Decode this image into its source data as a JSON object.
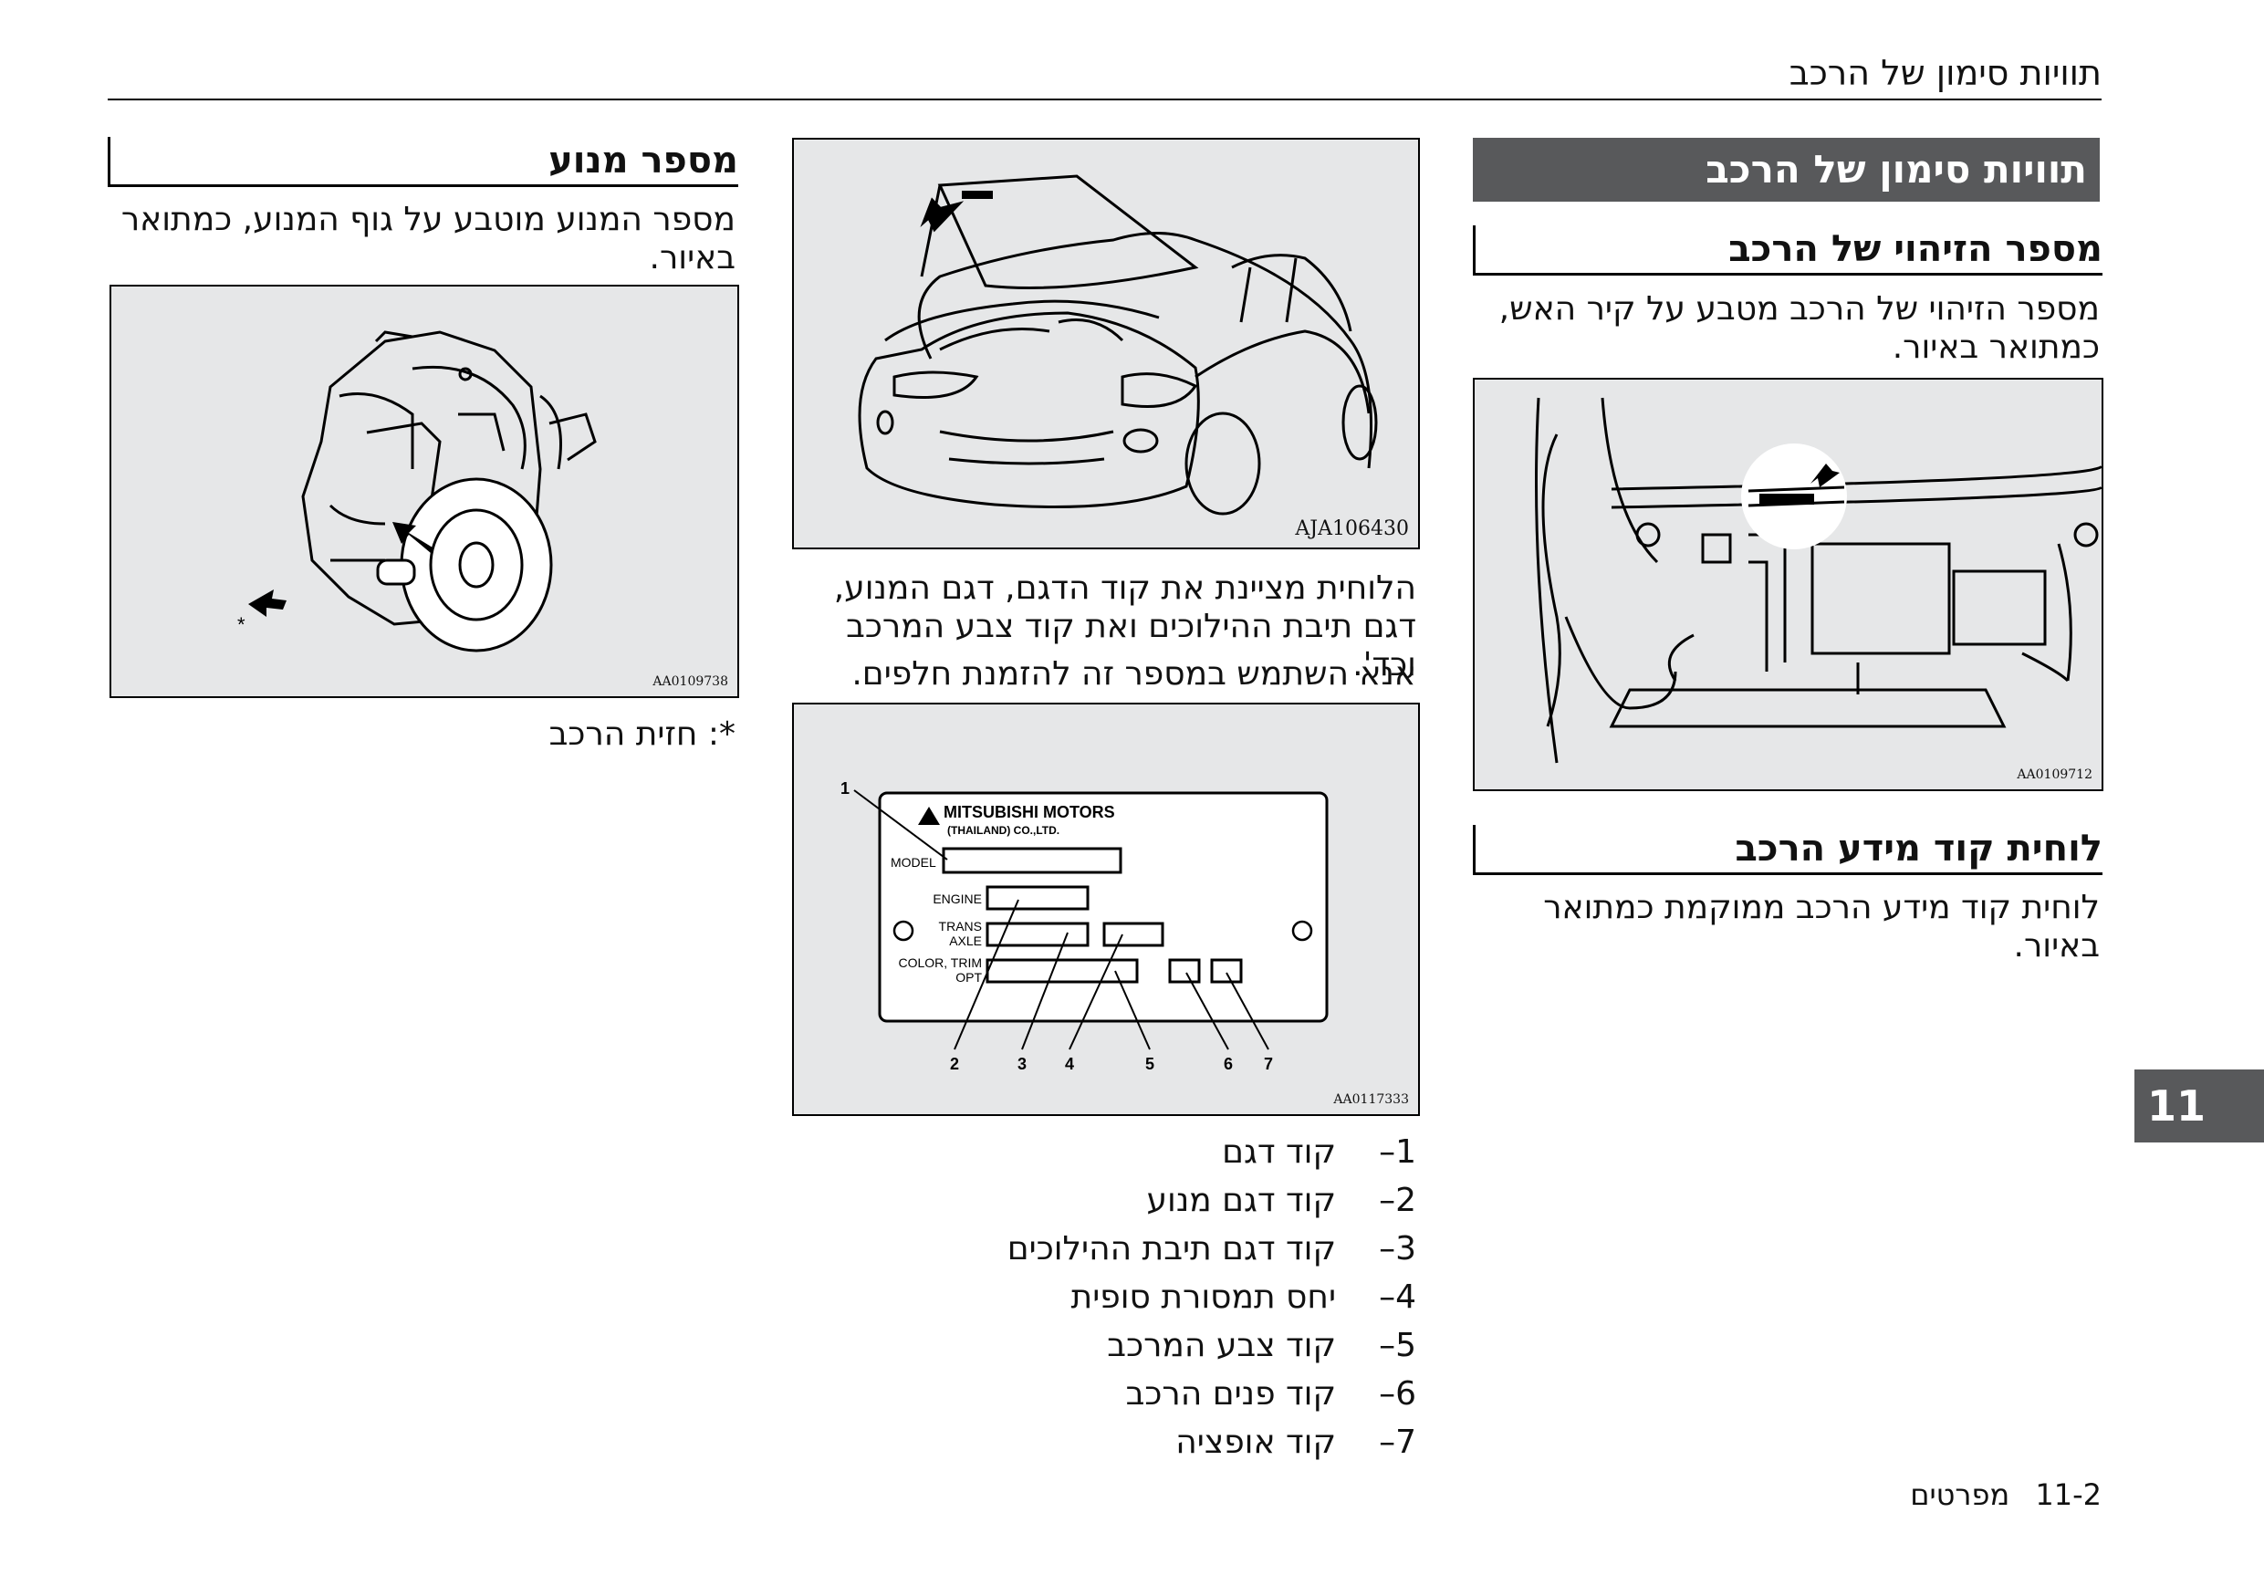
{
  "page_header": {
    "title": "תוויות סימון של הרכב"
  },
  "right_column": {
    "section_band": "תוויות סימון של הרכב",
    "vin": {
      "heading": "מספר הזיהוי של הרכב",
      "text": "מספר הזיהוי של הרכב מטבע על קיר האש, כמתואר באיור.",
      "figure_code": "AA0109712"
    },
    "info_plate": {
      "heading": "לוחית קוד מידע הרכב",
      "text": "לוחית קוד מידע הרכב ממוקמת כמתואר באיור."
    }
  },
  "middle_column": {
    "car_figure_code": "AJA106430",
    "text_1": "הלוחית מציינת את קוד הדגם, דגם המנוע, דגם תיבת ההילוכים ואת קוד צבע המרכב וכד'.",
    "text_2": "אנא השתמש במספר זה להזמנת חלפים.",
    "plate_figure": {
      "brand_line_1": "MITSUBISHI MOTORS",
      "brand_line_2": "(THAILAND) CO.,LTD.",
      "label_model": "MODEL",
      "label_engine": "ENGINE",
      "label_trans_1": "TRANS",
      "label_trans_2": "AXLE",
      "label_color": "COLOR, TRIM",
      "label_opt": "OPT",
      "callouts": [
        "1",
        "2",
        "3",
        "4",
        "5",
        "6",
        "7"
      ],
      "figure_code": "AA0117333"
    },
    "legend": [
      {
        "num": "1–",
        "text": "קוד דגם"
      },
      {
        "num": "2–",
        "text": "קוד דגם מנוע"
      },
      {
        "num": "3–",
        "text": "קוד דגם תיבת ההילוכים"
      },
      {
        "num": "4–",
        "text": "יחס תמסורת סופית"
      },
      {
        "num": "5–",
        "text": "קוד צבע המרכב"
      },
      {
        "num": "6–",
        "text": "קוד פנים הרכב"
      },
      {
        "num": "7–",
        "text": "קוד אופציה"
      }
    ]
  },
  "left_column": {
    "heading": "מספר מנוע",
    "text": "מספר המנוע מוטבע על גוף המנוע, כמתואר באיור.",
    "figure_code": "AA0109738",
    "figure_asterisk": "*",
    "note": "*: חזית הרכב"
  },
  "side_tab": "11",
  "footer": {
    "page_number": "11-2",
    "section_name": "מפרטים"
  }
}
